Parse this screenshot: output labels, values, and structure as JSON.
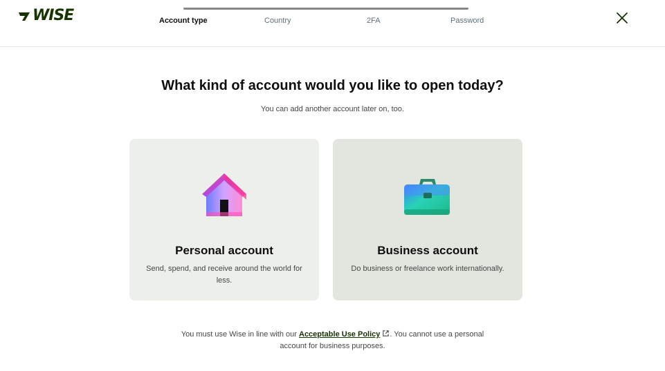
{
  "brand": {
    "name": "WISE",
    "color": "#163300"
  },
  "stepper": {
    "steps": [
      {
        "label": "Account type",
        "active": true
      },
      {
        "label": "Country",
        "active": false
      },
      {
        "label": "2FA",
        "active": false
      },
      {
        "label": "Password",
        "active": false
      }
    ]
  },
  "close": {
    "icon": "close-icon"
  },
  "main": {
    "title": "What kind of account would you like to open today?",
    "subtitle": "You can add another account later on, too."
  },
  "cards": [
    {
      "title": "Personal account",
      "description": "Send, spend, and receive around the world for less.",
      "icon": "house-icon"
    },
    {
      "title": "Business account",
      "description": "Do business or freelance work internationally.",
      "icon": "briefcase-icon"
    }
  ],
  "footer": {
    "before": "You must use Wise in line with our",
    "link": "Acceptable Use Policy",
    "after": ". You cannot use a personal account for business purposes.",
    "link_icon": "external-link-icon"
  }
}
